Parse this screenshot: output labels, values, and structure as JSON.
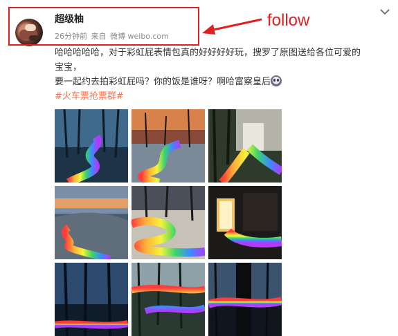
{
  "post": {
    "username": "超级柚",
    "time": "26分钟前",
    "source_prefix": "来自",
    "source": "微博 weibo.com",
    "text_line1": "哈哈哈哈哈，对于彩虹屁表情包真的好好好好玩，搜罗了原图送给各位可爱的",
    "text_line2": "宝宝，",
    "text_line3": "要一起约去拍彩虹屁吗？你的饭是谁呀？啊哈富察皇后",
    "hashtag": "#火车票抢票群#"
  },
  "annotation": {
    "label": "follow",
    "color": "#e02020"
  },
  "icons": {
    "menu": "chevron-down-icon",
    "emoji": "emoji-icon",
    "arrow": "arrow-left-icon"
  },
  "images": [
    {
      "scene": "dark forest with rainbow path"
    },
    {
      "scene": "sunset lake with rainbow path"
    },
    {
      "scene": "waterfall with rainbow path"
    },
    {
      "scene": "dusk hill with rainbow path"
    },
    {
      "scene": "snowy forest with rainbow path"
    },
    {
      "scene": "doorway with rainbow path"
    },
    {
      "scene": "night forest with rainbow path"
    },
    {
      "scene": "woods with rainbow path"
    },
    {
      "scene": "tree trunk with rainbow path"
    }
  ],
  "colors": {
    "hashtag": "#eb7350",
    "meta": "#888888"
  }
}
